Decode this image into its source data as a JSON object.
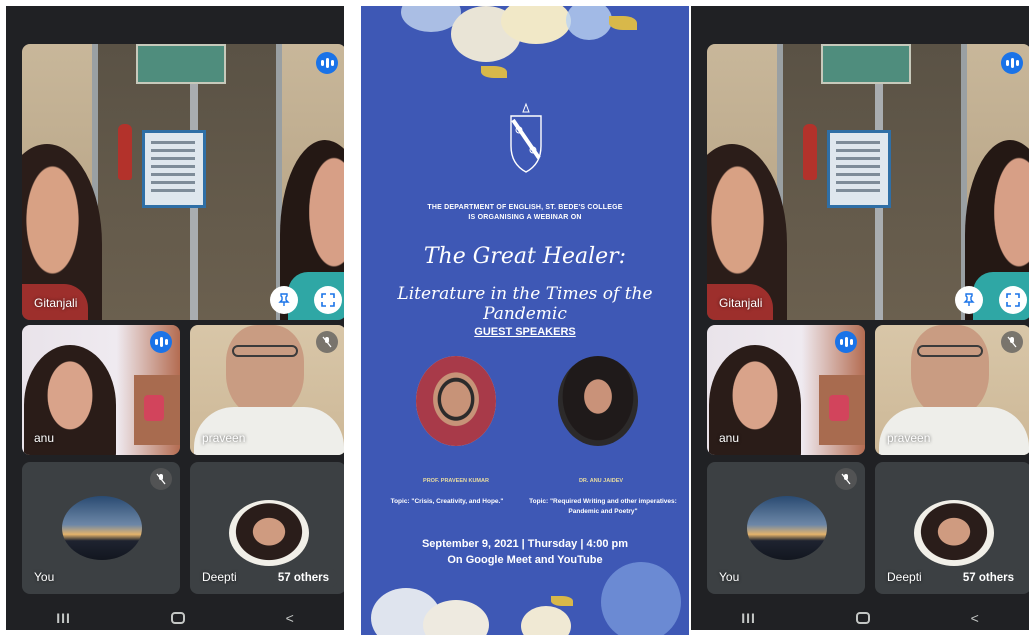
{
  "screens": [
    {
      "main": {
        "name": "Gitanjali"
      },
      "tiles": [
        {
          "name": "anu"
        },
        {
          "name": "praveen"
        },
        {
          "name": "You"
        },
        {
          "name": "Deepti"
        }
      ],
      "others": "57 others"
    },
    {
      "main": {
        "name": "Gitanjali"
      },
      "tiles": [
        {
          "name": "anu"
        },
        {
          "name": "praveen"
        },
        {
          "name": "You"
        },
        {
          "name": "Deepti"
        }
      ],
      "others": "57 others"
    }
  ],
  "icons": {
    "pin": "pin-icon",
    "fullscreen": "fullscreen-icon",
    "speaking": "audio-indicator-icon",
    "muted": "mic-off-icon"
  },
  "nav": {
    "recent": "III",
    "home": "home-icon",
    "back": "<"
  },
  "poster": {
    "org_line1": "THE DEPARTMENT OF ENGLISH, ST. BEDE'S COLLEGE",
    "org_line2": "IS ORGANISING A WEBINAR ON",
    "title_line1": "The Great Healer:",
    "title_line2": "Literature in the Times of the Pandemic",
    "guest_heading": "GUEST SPEAKERS",
    "speaker1_name": "PROF. PRAVEEN KUMAR",
    "speaker1_topic": "Topic: \"Crisis, Creativity, and Hope.\"",
    "speaker2_name": "DR. ANU JAIDEV",
    "speaker2_topic_line1": "Topic: \"Required Writing and other imperatives:",
    "speaker2_topic_line2": "Pandemic and Poetry\"",
    "date": "September 9, 2021 | Thursday | 4:00 pm",
    "venue": "On Google Meet and YouTube"
  },
  "colors": {
    "meet_bg": "#202124",
    "tile_bg": "#3c4043",
    "speaking": "#1a73e8",
    "poster_bg": "#3e58b5",
    "poster_gold": "#e8dca0"
  }
}
